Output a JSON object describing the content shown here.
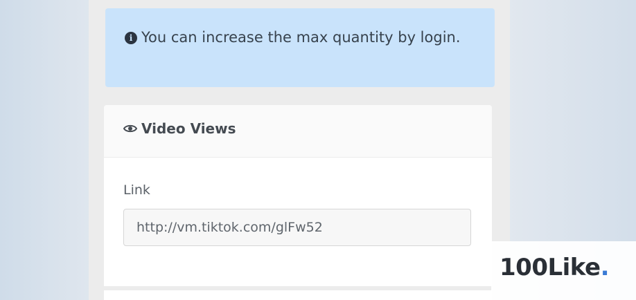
{
  "alert": {
    "icon": "info-icon",
    "message": "You can increase the max quantity by login."
  },
  "card": {
    "header_icon": "eye-icon",
    "title": "Video Views",
    "link_label": "Link",
    "link_value": "http://vm.tiktok.com/glFw52"
  },
  "watermark": {
    "text": "100Like",
    "dot": ".",
    "dot_color": "#3a7bd5"
  },
  "colors": {
    "alert_background": "#c9e3fb",
    "card_background": "#ffffff"
  }
}
